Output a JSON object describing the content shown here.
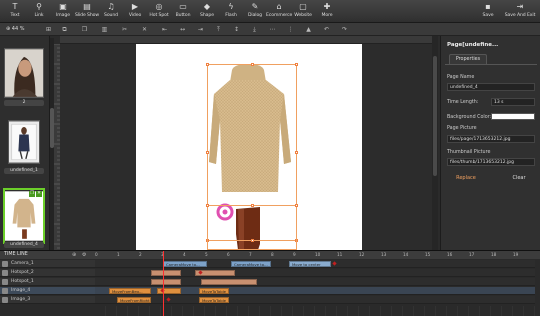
{
  "colors": {
    "accent": "#f0a060",
    "highlight": "#6ccf2a",
    "clip_camera": "#7da2c9",
    "clip_hotspot": "#c89070",
    "clip_image": "#e0903e"
  },
  "toolbar": {
    "tools": [
      {
        "label": "Text",
        "icon": "text-icon"
      },
      {
        "label": "Link",
        "icon": "link-icon"
      },
      {
        "label": "Image",
        "icon": "image-icon"
      },
      {
        "label": "Slide Show",
        "icon": "slideshow-icon"
      },
      {
        "label": "Sound",
        "icon": "sound-icon"
      },
      {
        "label": "Video",
        "icon": "video-icon"
      },
      {
        "label": "Hot Spot",
        "icon": "hotspot-icon"
      },
      {
        "label": "Button",
        "icon": "button-icon"
      },
      {
        "label": "Shape",
        "icon": "shape-icon"
      },
      {
        "label": "Flash",
        "icon": "flash-icon"
      },
      {
        "label": "Dialog",
        "icon": "dialog-icon"
      },
      {
        "label": "Ecommerce",
        "icon": "ecommerce-icon"
      },
      {
        "label": "Website",
        "icon": "website-icon"
      },
      {
        "label": "More",
        "icon": "more-icon"
      }
    ],
    "save": "Save",
    "save_exit": "Save And Exit"
  },
  "subbar": {
    "zoom": "44 %"
  },
  "thumbnails": [
    {
      "label": "2"
    },
    {
      "label": "undefined_1"
    },
    {
      "label": "undefined_4"
    }
  ],
  "props": {
    "title": "Page[undefine...",
    "tab": "Properties",
    "page_name_label": "Page Name",
    "page_name": "undefined_4",
    "time_length_label": "Time Length:",
    "time_length": "13 s",
    "bg_color_label": "Background Color:",
    "page_picture_label": "Page Picture",
    "page_picture": "files/page/1713653212.jpg",
    "thumb_picture_label": "Thumbnail Picture",
    "thumb_picture": "files/thumb/1713653212.jpg",
    "replace": "Replace",
    "clear": "Clear"
  },
  "timeline": {
    "title": "TIME LINE",
    "ticks": [
      "0",
      "1",
      "2",
      "3",
      "4",
      "5",
      "6",
      "7",
      "8",
      "9",
      "10",
      "11",
      "12",
      "13",
      "14",
      "15",
      "16",
      "17",
      "18",
      "19"
    ],
    "layers": [
      {
        "name": "Camera_1"
      },
      {
        "name": "Hotspot_2"
      },
      {
        "name": "Hotspot_1"
      },
      {
        "name": "Image_4"
      },
      {
        "name": "Image_3"
      }
    ],
    "clips": {
      "camera1": "CameraMove to...",
      "camera2": "CameraMove to...",
      "camera3": "Move to center",
      "img4a": "MoveFromBeg...",
      "img4b": "MoveToTable",
      "img3a": "MoveFromRight",
      "img3b": "MoveToTable"
    }
  }
}
